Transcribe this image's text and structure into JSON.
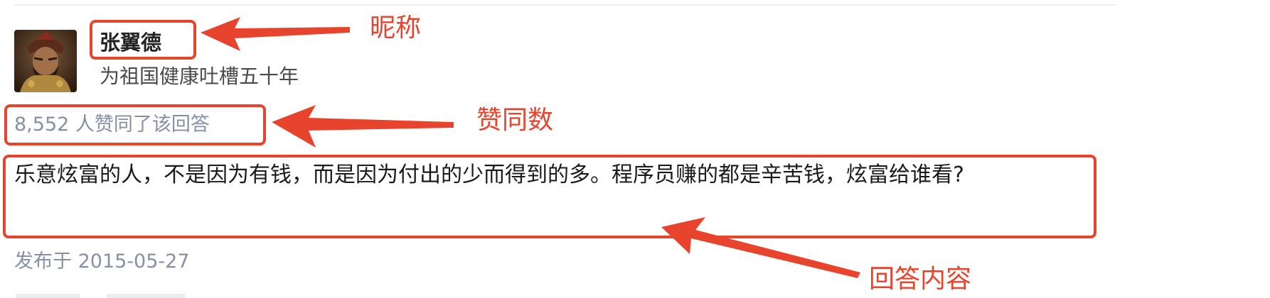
{
  "author": {
    "avatar": "avatar-image",
    "nickname": "张翼德",
    "bio": "为祖国健康吐槽五十年"
  },
  "answer": {
    "vote_count_text": "8,552 人赞同了该回答",
    "content": "乐意炫富的人，不是因为有钱，而是因为付出的少而得到的多。程序员赚的都是辛苦钱，炫富给谁看?",
    "publish_time": "发布于 2015-05-27"
  },
  "annotations": {
    "nickname_label": "昵称",
    "vote_label": "赞同数",
    "content_label": "回答内容",
    "color": "#e8432c"
  },
  "colors": {
    "meta_text": "#8590a6",
    "body_text": "#1a1a1a"
  }
}
